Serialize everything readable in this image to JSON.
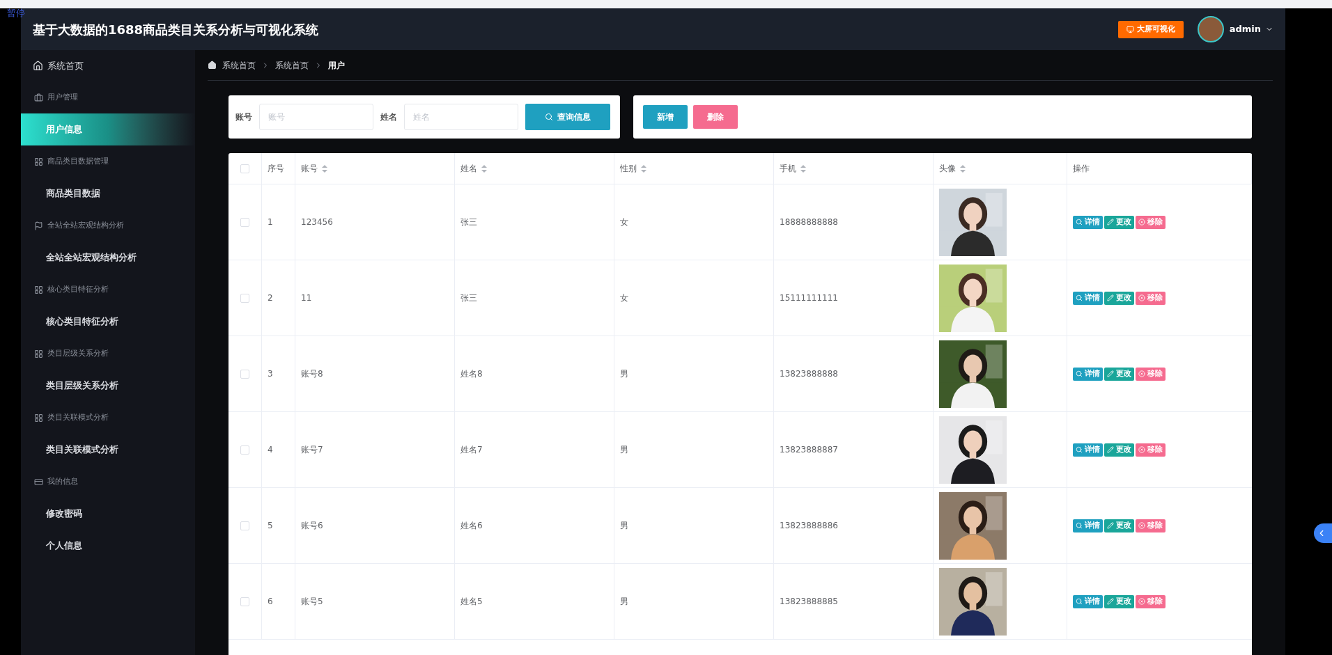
{
  "overlay_label": "暂停",
  "header": {
    "title": "基于大数据的1688商品类目关系分析与可视化系统",
    "bigscreen_button": "大屏可视化",
    "user": "admin"
  },
  "sidebar": {
    "home": {
      "label": "系统首页",
      "selected": false
    },
    "groups": [
      {
        "label": "用户管理",
        "kind": "briefcase",
        "items": [
          {
            "label": "用户信息",
            "selected": true
          }
        ]
      },
      {
        "label": "商品类目数据管理",
        "kind": "grid",
        "items": [
          {
            "label": "商品类目数据",
            "selected": false
          }
        ]
      },
      {
        "label": "全站全站宏观结构分析",
        "kind": "flag",
        "items": [
          {
            "label": "全站全站宏观结构分析",
            "selected": false
          }
        ]
      },
      {
        "label": "核心类目特征分析",
        "kind": "grid",
        "items": [
          {
            "label": "核心类目特征分析",
            "selected": false
          }
        ]
      },
      {
        "label": "类目层级关系分析",
        "kind": "grid",
        "items": [
          {
            "label": "类目层级关系分析",
            "selected": false
          }
        ]
      },
      {
        "label": "类目关联模式分析",
        "kind": "grid",
        "items": [
          {
            "label": "类目关联模式分析",
            "selected": false
          }
        ]
      },
      {
        "label": "我的信息",
        "kind": "card",
        "items": [
          {
            "label": "修改密码",
            "selected": false
          },
          {
            "label": "个人信息",
            "selected": false
          }
        ]
      }
    ]
  },
  "breadcrumb": [
    "系统首页",
    "系统首页",
    "用户"
  ],
  "search": {
    "fields": [
      {
        "label": "账号",
        "placeholder": "账号"
      },
      {
        "label": "姓名",
        "placeholder": "姓名"
      }
    ],
    "button": "查询信息"
  },
  "actions": [
    {
      "label": "新增",
      "kind": "add"
    },
    {
      "label": "删除",
      "kind": "delete"
    }
  ],
  "table": {
    "select_all_checked": false,
    "columns": [
      {
        "label": "序号",
        "sortable": false
      },
      {
        "label": "账号",
        "sortable": true
      },
      {
        "label": "姓名",
        "sortable": true
      },
      {
        "label": "性别",
        "sortable": true
      },
      {
        "label": "手机",
        "sortable": true
      },
      {
        "label": "头像",
        "sortable": true
      },
      {
        "label": "操作",
        "sortable": false
      }
    ],
    "rows": [
      {
        "checked": false,
        "cells": [
          "1",
          "123456",
          "张三",
          "女",
          "18888888888"
        ],
        "avatar": {
          "kind": "picture"
        },
        "actions": [
          {
            "label": "详情",
            "kind": "detail"
          },
          {
            "label": "更改",
            "kind": "edit"
          },
          {
            "label": "移除",
            "kind": "remove"
          }
        ]
      },
      {
        "checked": false,
        "cells": [
          "2",
          "11",
          "张三",
          "女",
          "15111111111"
        ],
        "avatar": {
          "kind": "picture"
        },
        "actions": [
          {
            "label": "详情",
            "kind": "detail"
          },
          {
            "label": "更改",
            "kind": "edit"
          },
          {
            "label": "移除",
            "kind": "remove"
          }
        ]
      },
      {
        "checked": false,
        "cells": [
          "3",
          "账号8",
          "姓名8",
          "男",
          "13823888888"
        ],
        "avatar": {
          "kind": "picture"
        },
        "actions": [
          {
            "label": "详情",
            "kind": "detail"
          },
          {
            "label": "更改",
            "kind": "edit"
          },
          {
            "label": "移除",
            "kind": "remove"
          }
        ]
      },
      {
        "checked": false,
        "cells": [
          "4",
          "账号7",
          "姓名7",
          "男",
          "13823888887"
        ],
        "avatar": {
          "kind": "picture"
        },
        "actions": [
          {
            "label": "详情",
            "kind": "detail"
          },
          {
            "label": "更改",
            "kind": "edit"
          },
          {
            "label": "移除",
            "kind": "remove"
          }
        ]
      },
      {
        "checked": false,
        "cells": [
          "5",
          "账号6",
          "姓名6",
          "男",
          "13823888886"
        ],
        "avatar": {
          "kind": "picture"
        },
        "actions": [
          {
            "label": "详情",
            "kind": "detail"
          },
          {
            "label": "更改",
            "kind": "edit"
          },
          {
            "label": "移除",
            "kind": "remove"
          }
        ]
      },
      {
        "checked": false,
        "cells": [
          "6",
          "账号5",
          "姓名5",
          "男",
          "13823888885"
        ],
        "avatar": {
          "kind": "picture"
        },
        "actions": [
          {
            "label": "详情",
            "kind": "detail"
          },
          {
            "label": "更改",
            "kind": "edit"
          },
          {
            "label": "移除",
            "kind": "remove"
          }
        ]
      }
    ]
  }
}
